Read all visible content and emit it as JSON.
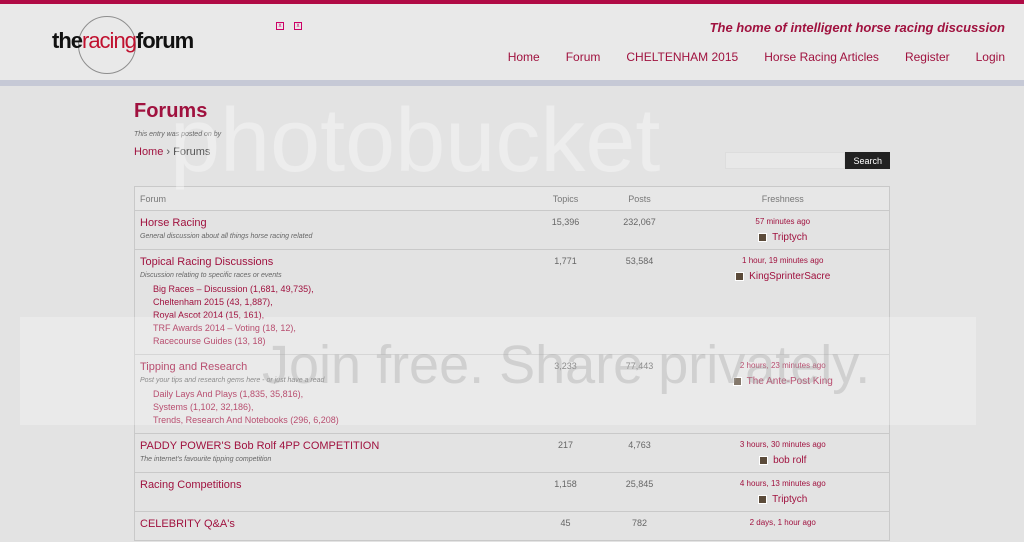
{
  "header": {
    "logo_the": "the",
    "logo_racing": "racing",
    "logo_forum": "forum",
    "tagline": "The home of intelligent horse racing discussion",
    "nav": [
      "Home",
      "Forum",
      "CHELTENHAM 2015",
      "Horse Racing Articles",
      "Register",
      "Login"
    ]
  },
  "page": {
    "title": "Forums",
    "posted": "This entry was posted on by",
    "breadcrumb_home": "Home",
    "breadcrumb_sep": " › ",
    "breadcrumb_current": "Forums",
    "search_button": "Search"
  },
  "table": {
    "headers": [
      "Forum",
      "Topics",
      "Posts",
      "Freshness"
    ],
    "rows": [
      {
        "title": "Horse Racing",
        "description": "General discussion about all things horse racing related",
        "subforums": [],
        "topics": "15,396",
        "posts": "232,067",
        "fresh_time": "57 minutes ago",
        "fresh_user": "Triptych"
      },
      {
        "title": "Topical Racing Discussions",
        "description": "Discussion relating to specific races or events",
        "subforums": [
          "Big Races – Discussion (1,681, 49,735),",
          "Cheltenham 2015 (43, 1,887),",
          "Royal Ascot 2014 (15, 161),",
          "TRF Awards 2014 – Voting (18, 12),",
          "Racecourse Guides (13, 18)"
        ],
        "topics": "1,771",
        "posts": "53,584",
        "fresh_time": "1 hour, 19 minutes ago",
        "fresh_user": "KingSprinterSacre"
      },
      {
        "title": "Tipping and Research",
        "description": "Post your tips and research gems here - or just have a read",
        "subforums": [
          "Daily Lays And Plays (1,835, 35,816),",
          "Systems (1,102, 32,186),",
          "Trends, Research And Notebooks (296, 6,208)"
        ],
        "topics": "3,233",
        "posts": "77,443",
        "fresh_time": "2 hours, 23 minutes ago",
        "fresh_user": "The Ante-Post King"
      },
      {
        "title": "PADDY POWER'S Bob Rolf 4PP COMPETITION",
        "description": "The internet's favourite tipping competition",
        "subforums": [],
        "topics": "217",
        "posts": "4,763",
        "fresh_time": "3 hours, 30 minutes ago",
        "fresh_user": "bob rolf"
      },
      {
        "title": "Racing Competitions",
        "description": "",
        "subforums": [],
        "topics": "1,158",
        "posts": "25,845",
        "fresh_time": "4 hours, 13 minutes ago",
        "fresh_user": "Triptych"
      },
      {
        "title": "CELEBRITY Q&A's",
        "description": "",
        "subforums": [],
        "topics": "45",
        "posts": "782",
        "fresh_time": "2 days, 1 hour ago",
        "fresh_user": ""
      }
    ]
  },
  "watermark": {
    "line1": "photobucket",
    "line2": "Join free. Share privately."
  }
}
